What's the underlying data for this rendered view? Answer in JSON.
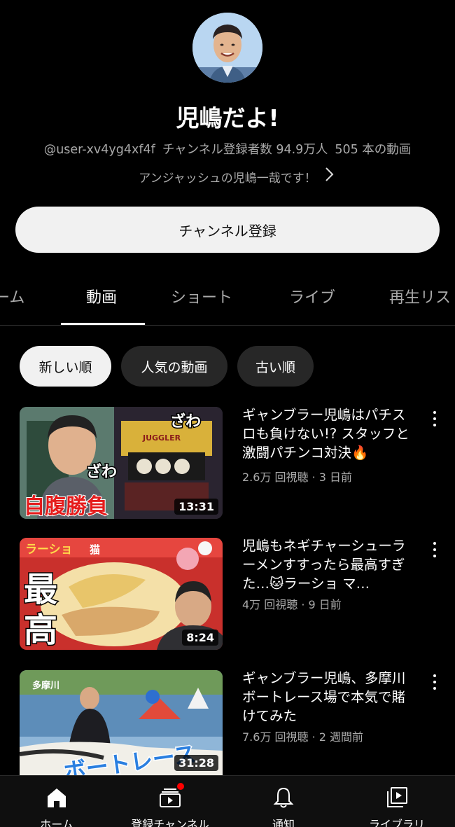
{
  "channel": {
    "name": "児嶋だよ!",
    "handle": "@user-xv4yg4xf4f",
    "subscribers": "チャンネル登録者数 94.9万人",
    "video_count": "505 本の動画",
    "description": "アンジャッシュの児嶋一哉です！"
  },
  "subscribe_label": "チャンネル登録",
  "tabs": [
    "ーム",
    "動画",
    "ショート",
    "ライブ",
    "再生リス"
  ],
  "active_tab": "動画",
  "sort_chips": [
    "新しい順",
    "人気の動画",
    "古い順"
  ],
  "active_chip": "新しい順",
  "videos": [
    {
      "title": "ギャンブラー児嶋はパチスロも負けない!? スタッフと激闘パチンコ対決🔥",
      "meta": "2.6万 回視聴 · 3 日前",
      "duration": "13:31",
      "thumb_text": [
        "自腹勝負",
        "ざわ",
        "ざわ",
        "JUGGLER"
      ]
    },
    {
      "title": "児嶋もネギチャーシューラーメンすすったら最高すぎた…🐱ラーショ マ…",
      "meta": "4万 回視聴 · 9 日前",
      "duration": "8:24",
      "thumb_text": [
        "最",
        "高",
        "ラーショ",
        "猫"
      ]
    },
    {
      "title": "ギャンブラー児嶋、多摩川ボートレース場で本気で賭けてみた",
      "meta": "7.6万 回視聴 · 2 週間前",
      "duration": "31:28",
      "thumb_text": [
        "ボートレース",
        "多摩川"
      ]
    }
  ],
  "bottom_nav": [
    {
      "label": "ホーム",
      "icon": "home-icon"
    },
    {
      "label": "登録チャンネル",
      "icon": "subscriptions-icon"
    },
    {
      "label": "通知",
      "icon": "bell-icon"
    },
    {
      "label": "ライブラリ",
      "icon": "library-icon"
    }
  ],
  "colors": {
    "background": "#000000",
    "chip_active": "#f1f1f1",
    "notification_dot": "#ff0000",
    "muted_text": "#aaaaaa"
  }
}
